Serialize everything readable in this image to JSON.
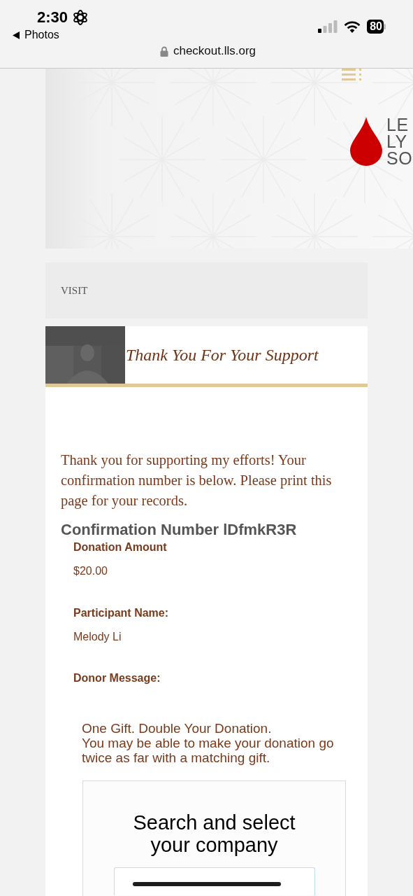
{
  "status_bar": {
    "time": "2:30",
    "back_label": "Photos",
    "url": "checkout.lls.org",
    "battery": "80"
  },
  "header": {
    "logo_lines": [
      "LE",
      "LY",
      "SO"
    ]
  },
  "visit": "VISIT",
  "banner": {
    "title": "Thank You For Your Support"
  },
  "message": "Thank you for supporting my efforts! Your confirmation number is below. Please print this page for your records.",
  "confirmation": "Confirmation Number lDfmkR3R",
  "fields": [
    {
      "label": "Donation Amount",
      "value": "$20.00"
    },
    {
      "label": "Participant Name:",
      "value": "Melody Li"
    },
    {
      "label": "Donor Message:"
    }
  ],
  "matching": {
    "headline": "One Gift. Double Your Donation.",
    "text": "You may be able to make your donation go twice as far with a matching gift.",
    "search_title": "Search and select your company"
  }
}
